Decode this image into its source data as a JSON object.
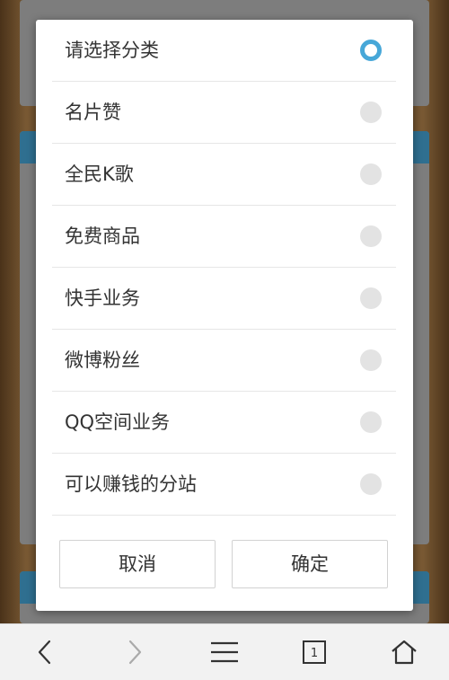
{
  "dialog": {
    "options": [
      {
        "label": "请选择分类",
        "selected": true
      },
      {
        "label": "名片赞",
        "selected": false
      },
      {
        "label": "全民K歌",
        "selected": false
      },
      {
        "label": "免费商品",
        "selected": false
      },
      {
        "label": "快手业务",
        "selected": false
      },
      {
        "label": "微博粉丝",
        "selected": false
      },
      {
        "label": "QQ空间业务",
        "selected": false
      },
      {
        "label": "可以赚钱的分站",
        "selected": false
      }
    ],
    "cancel_label": "取消",
    "ok_label": "确定"
  },
  "navbar": {
    "tab_count": "1",
    "icons": [
      "back-icon",
      "forward-icon",
      "menu-icon",
      "tabs-icon",
      "home-icon"
    ]
  },
  "colors": {
    "accent": "#47a7d8",
    "radio_unselected": "#e3e3e3",
    "background_band": "#2f6f90"
  }
}
